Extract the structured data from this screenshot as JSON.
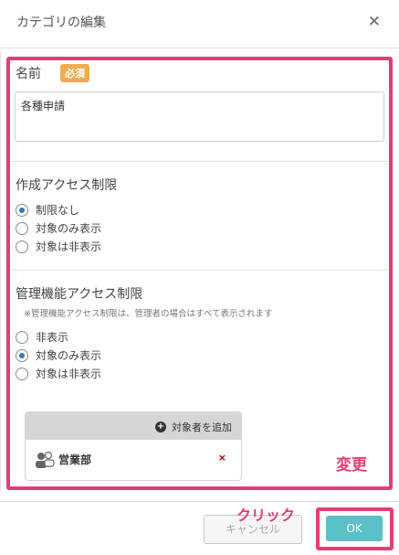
{
  "dialog": {
    "title": "カテゴリの編集",
    "close_symbol": "×"
  },
  "name_field": {
    "label": "名前",
    "required_badge": "必須",
    "value": "各種申請"
  },
  "create_access": {
    "label": "作成アクセス制限",
    "options": [
      "制限なし",
      "対象のみ表示",
      "対象は非表示"
    ],
    "selected": "制限なし"
  },
  "admin_access": {
    "label": "管理機能アクセス制限",
    "note": "※管理機能アクセス制限は、管理者の場合はすべて表示されます",
    "options": [
      "非表示",
      "対象のみ表示",
      "対象は非表示"
    ],
    "selected": "対象のみ表示"
  },
  "targets": {
    "add_label": "対象者を追加",
    "items": [
      {
        "name": "営業部",
        "icon": "group-icon",
        "remove_symbol": "×"
      }
    ]
  },
  "annotations": {
    "change_label": "変更",
    "click_label": "クリック",
    "highlight_color": "#e63b7a"
  },
  "footer": {
    "cancel_label": "キャンセル",
    "ok_label": "OK"
  },
  "colors": {
    "ok_button": "#5bc0c8",
    "required_badge": "#f0ad4e",
    "radio_selected": "#337ab7"
  }
}
